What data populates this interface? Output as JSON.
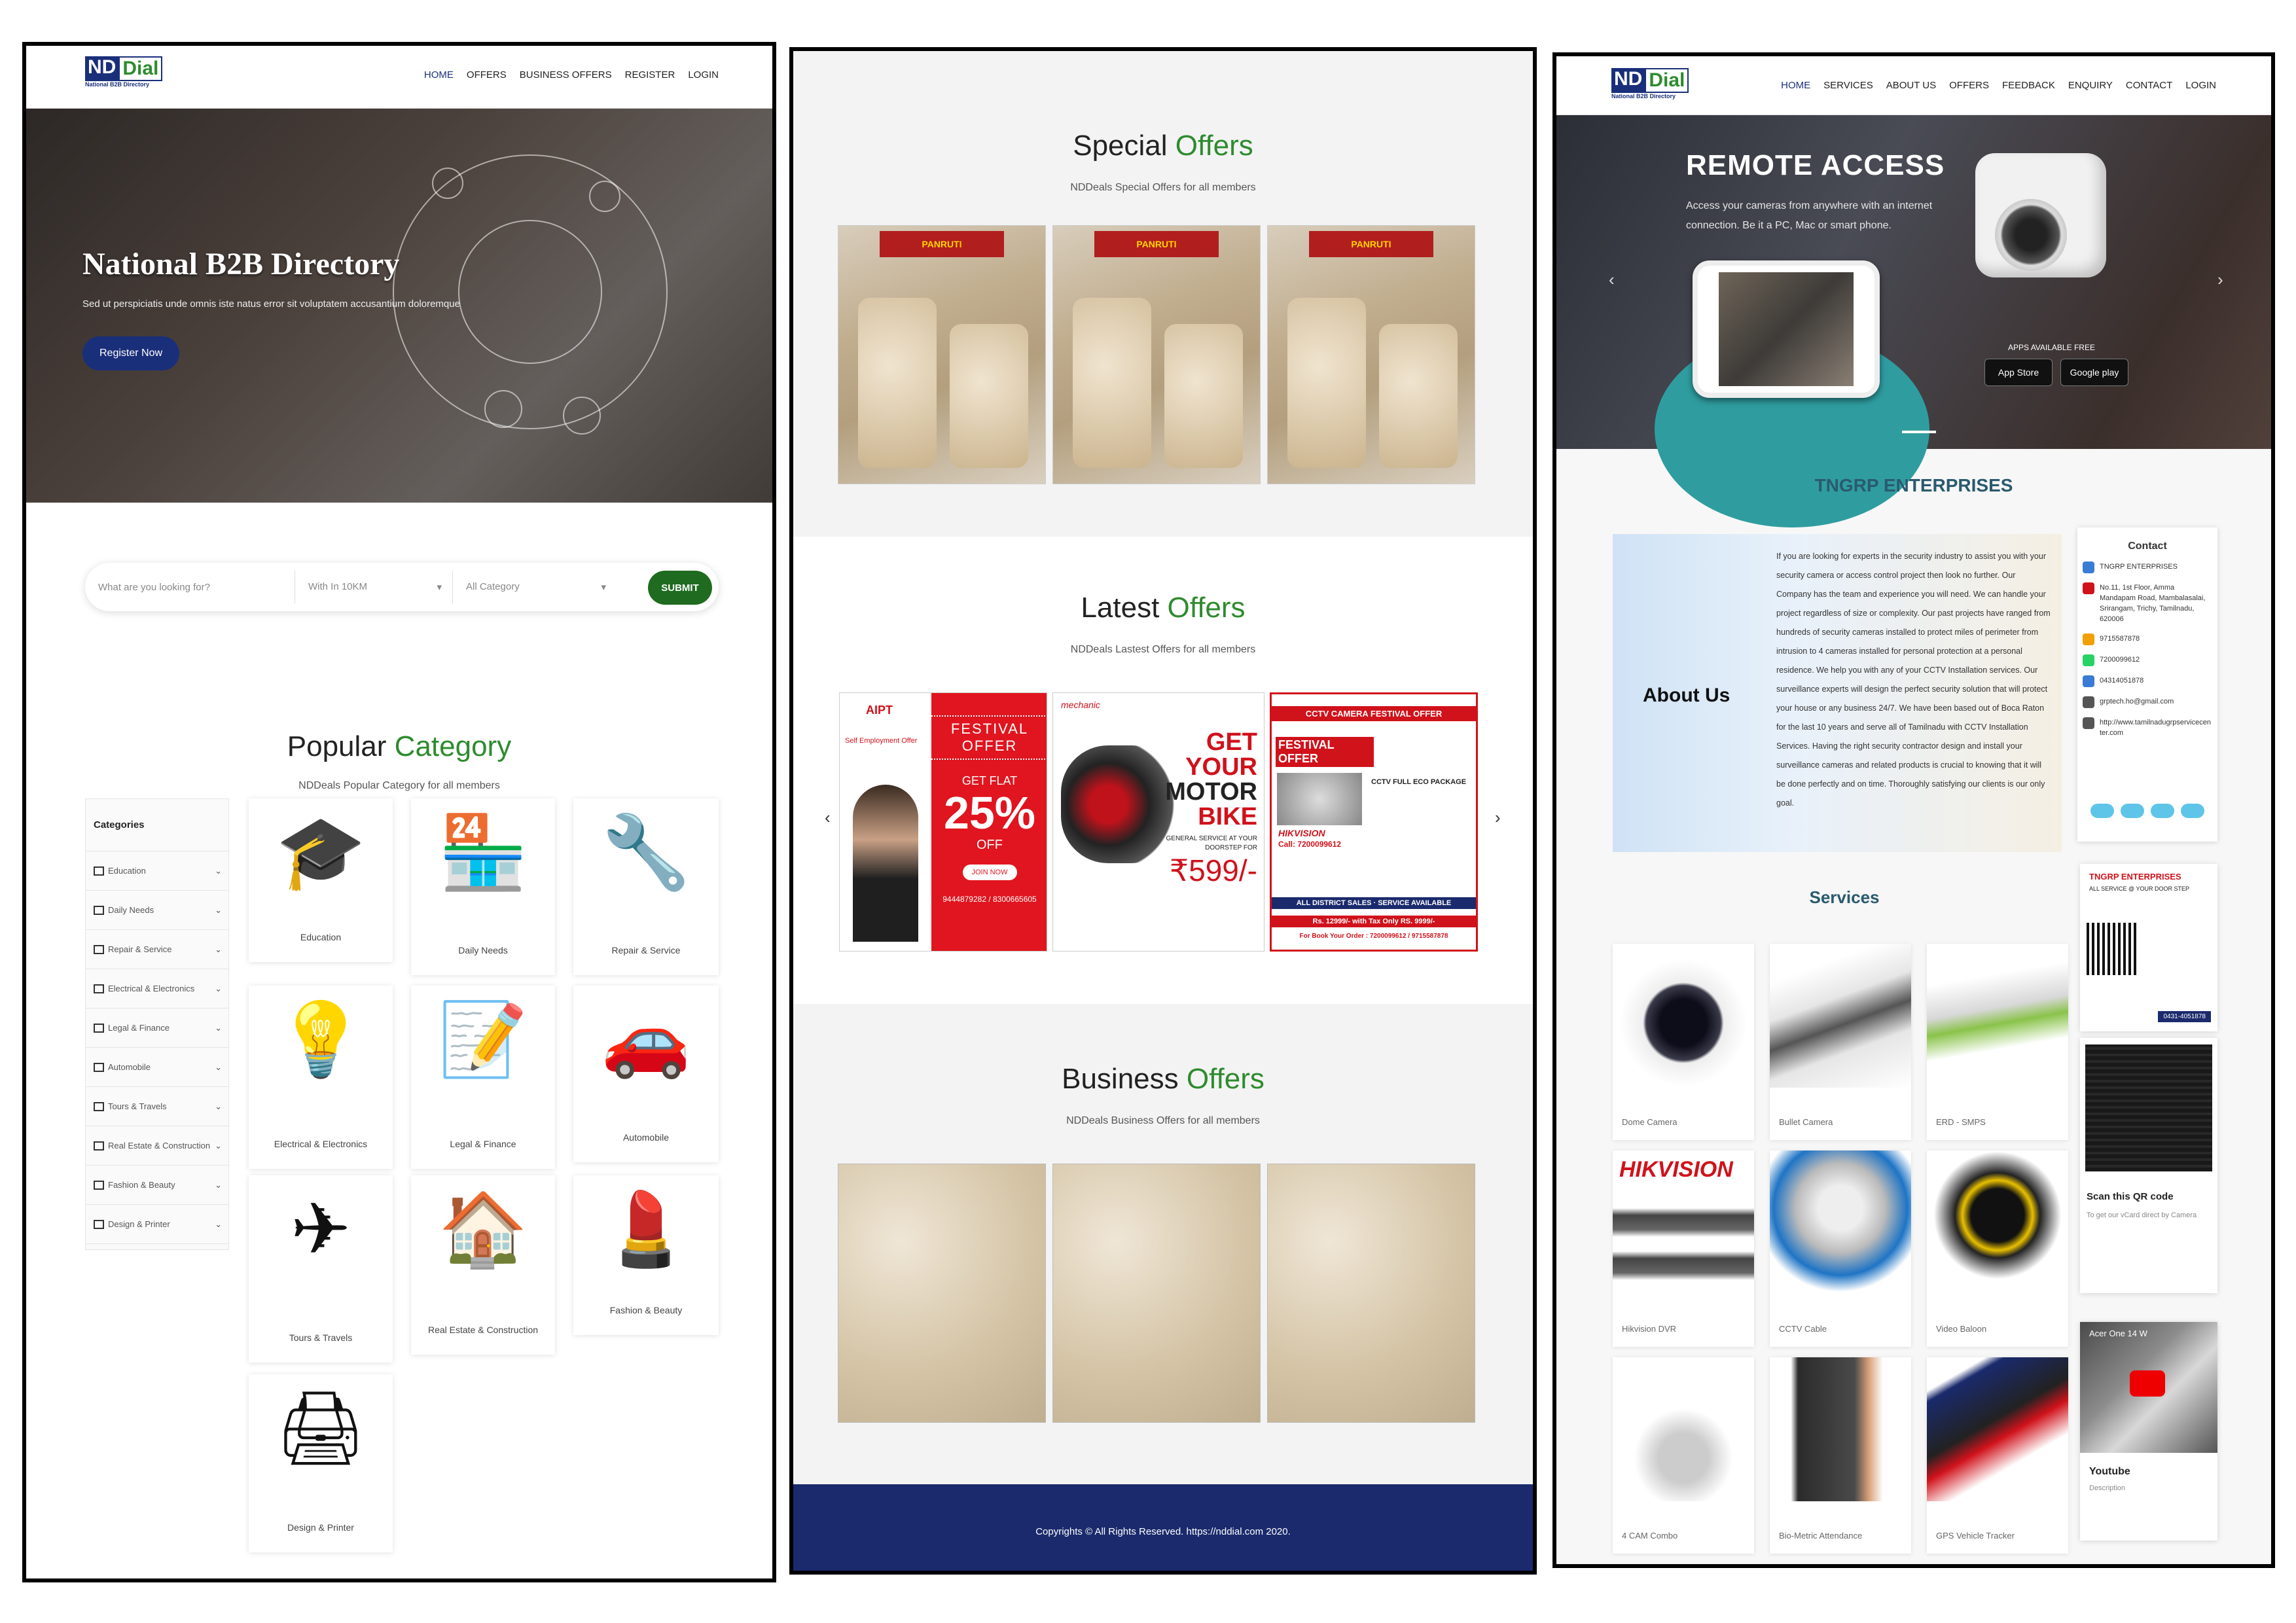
{
  "panel1": {
    "logo": {
      "nd": "ND",
      "dial": "Dial",
      "sub": "National B2B Directory"
    },
    "nav": [
      "HOME",
      "OFFERS",
      "BUSINESS OFFERS",
      "REGISTER",
      "LOGIN"
    ],
    "hero": {
      "title": "National B2B Directory",
      "subtitle": "Sed ut perspiciatis unde omnis iste natus error sit voluptatem accusantium doloremque",
      "button": "Register Now"
    },
    "search": {
      "placeholder": "What are you looking for?",
      "distance": "With In 10KM",
      "category": "All Category",
      "submit": "SUBMIT"
    },
    "popular": {
      "title_a": "Popular",
      "title_b": "Category",
      "subtitle": "NDDeals Popular Category for all members"
    },
    "categories_head": "Categories",
    "categories": [
      "Education",
      "Daily Needs",
      "Repair & Service",
      "Electrical & Electronics",
      "Legal & Finance",
      "Automobile",
      "Tours & Travels",
      "Real Estate & Construction",
      "Fashion & Beauty",
      "Design & Printer"
    ],
    "cards": [
      {
        "label": "Education",
        "glyph": "🎓"
      },
      {
        "label": "Daily Needs",
        "glyph": "🏪"
      },
      {
        "label": "Repair & Service",
        "glyph": "🔧"
      },
      {
        "label": "Electrical & Electronics",
        "glyph": "💡"
      },
      {
        "label": "Legal & Finance",
        "glyph": "📝"
      },
      {
        "label": "Automobile",
        "glyph": "🚗"
      },
      {
        "label": "Tours & Travels",
        "glyph": "✈"
      },
      {
        "label": "Real Estate & Construction",
        "glyph": "🏠"
      },
      {
        "label": "Fashion & Beauty",
        "glyph": "💄"
      },
      {
        "label": "Design & Printer",
        "glyph": "🖨"
      }
    ]
  },
  "panel2": {
    "special": {
      "title_a": "Special",
      "title_b": "Offers",
      "subtitle": "NDDeals Special Offers for all members"
    },
    "latest": {
      "title_a": "Latest",
      "title_b": "Offers",
      "subtitle": "NDDeals Lastest Offers for all members"
    },
    "business": {
      "title_a": "Business",
      "title_b": "Offers",
      "subtitle": "NDDeals Business Offers for all members"
    },
    "cashew_tag": "PANRUTI",
    "banner1": {
      "brand": "AIPT",
      "tag": "Self Employment Offer",
      "fest": "FESTIVAL OFFER",
      "get": "GET FLAT",
      "pct": "25%",
      "off": "OFF",
      "join": "JOIN NOW",
      "phone": "9444879282 / 8300665605"
    },
    "banner2": {
      "brand": "mechanic",
      "l1": "GET YOUR",
      "l2": "MOTOR",
      "l3": "BIKE",
      "l4": "GENERAL SERVICE AT YOUR DOORSTEP FOR",
      "price": "₹599/-"
    },
    "banner3": {
      "top": "CCTV CAMERA FESTIVAL OFFER",
      "fest": "FESTIVAL OFFER",
      "brand": "HIKVISION",
      "call": "Call: 7200099612",
      "pkg": "CCTV FULL ECO PACKAGE",
      "sales": "ALL DISTRICT SALES · SERVICE AVAILABLE",
      "price": "Rs. 12999/- with Tax Only RS. 9999/-",
      "order": "For Book Your Order : 7200099612 / 9715587878"
    },
    "footer": "Copyrights © All Rights Reserved. https://nddial.com 2020."
  },
  "panel3": {
    "logo": {
      "nd": "ND",
      "dial": "Dial",
      "sub": "National B2B Directory"
    },
    "nav": [
      "HOME",
      "SERVICES",
      "ABOUT US",
      "OFFERS",
      "FEEDBACK",
      "ENQUIRY",
      "CONTACT",
      "LOGIN"
    ],
    "hero": {
      "title": "REMOTE ACCESS",
      "text": "Access your cameras from anywhere with an internet connection. Be it a PC, Mac or smart phone.",
      "apps": "APPS AVAILABLE FREE",
      "appstore": "App Store",
      "googleplay": "Google play"
    },
    "company": "TNGRP ENTERPRISES",
    "about": {
      "title": "About Us",
      "text": "If you are looking for experts in the security industry to assist you with your security camera or access control project then look no further. Our Company has the team and experience you will need. We can handle your project regardless of size or complexity. Our past projects have ranged from hundreds of security cameras installed to protect miles of perimeter from intrusion to 4 cameras installed for personal protection at a personal residence. We help you with any of your CCTV Installation services. Our surveillance experts will design the perfect security solution that will protect your house or any business 24/7. We have been based out of Boca Raton for the last 10 years and serve all of Tamilnadu with CCTV Installation Services. Having the right security contractor design and install your surveillance cameras and related products is crucial to knowing that it will be done perfectly and on time. Thoroughly satisfying our clients is our only goal."
    },
    "contact": {
      "title": "Contact",
      "name": "TNGRP ENTERPRISES",
      "address": "No.11, 1st Floor, Amma Mandapam Road, Mambalasalai, Srirangam, Trichy, Tamilnadu, 620006",
      "phone1": "9715587878",
      "whatsapp": "7200099612",
      "phone2": "04314051878",
      "email": "grptech.ho@gmail.com",
      "web": "http://www.tamilnadugrpservicecenter.com"
    },
    "services_title": "Services",
    "services": [
      "Dome Camera",
      "Bullet Camera",
      "ERD - SMPS",
      "Hikvision DVR",
      "CCTV Cable",
      "Video Baloon",
      "4 CAM Combo",
      "Bio-Metric Attendance",
      "GPS Vehicle Tracker"
    ],
    "hik_label": "HIKVISION",
    "vcard": {
      "company": "TNGRP ENTERPRISES",
      "line": "ALL SERVICE @ YOUR DOOR STEP",
      "phone": "0431-4051878"
    },
    "qr": {
      "title": "Scan this QR code",
      "sub": "To get our vCard direct by Camera"
    },
    "youtube": {
      "title": "Youtube",
      "sub": "Description",
      "video": "Acer One 14 W"
    }
  }
}
